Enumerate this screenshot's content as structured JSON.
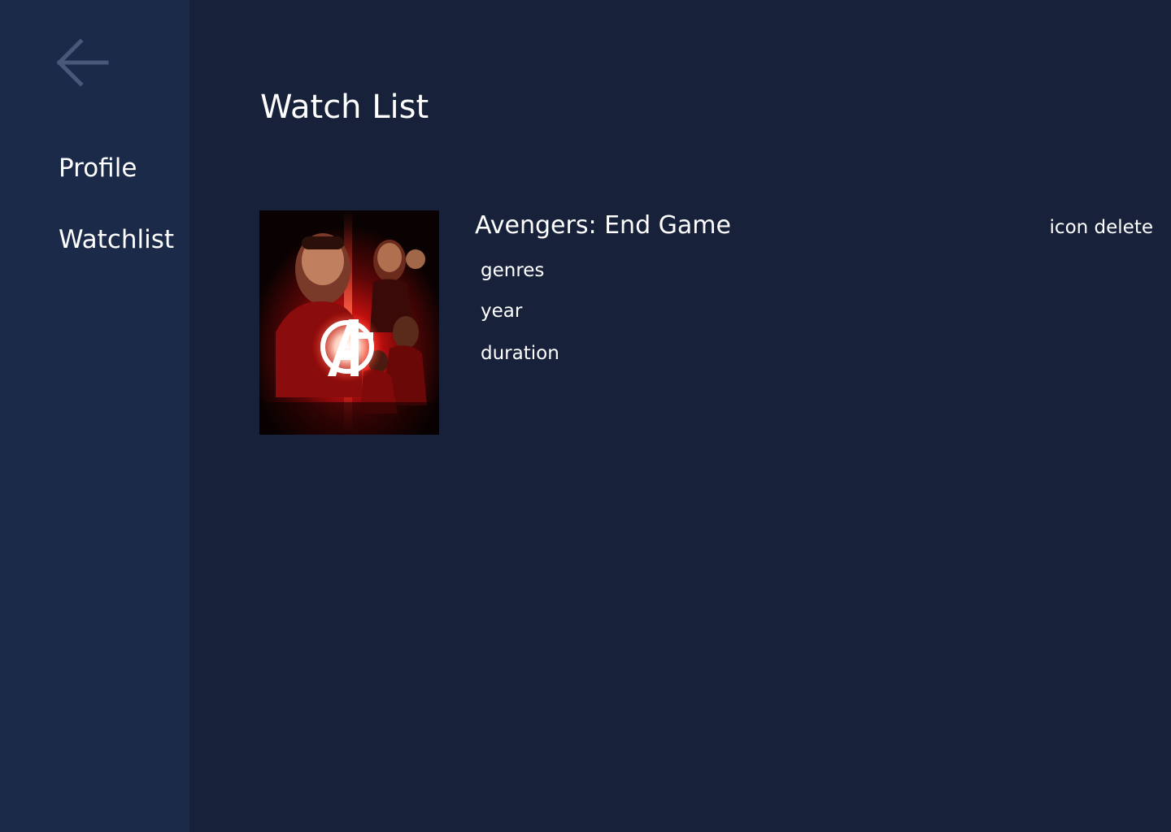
{
  "sidebar": {
    "back_icon": "arrow-left-icon",
    "items": [
      {
        "label": "Profile"
      },
      {
        "label": "Watchlist"
      }
    ]
  },
  "main": {
    "title": "Watch List",
    "items": [
      {
        "title": "Avengers: End Game",
        "genres": "genres",
        "year": "year",
        "duration": "duration",
        "delete_label": "icon delete",
        "poster_icon": "avengers-logo-icon"
      }
    ]
  },
  "colors": {
    "sidebar_bg": "#1b2a48",
    "main_bg": "#17213a",
    "back_icon": "#4a5778",
    "text": "#ffffff"
  }
}
